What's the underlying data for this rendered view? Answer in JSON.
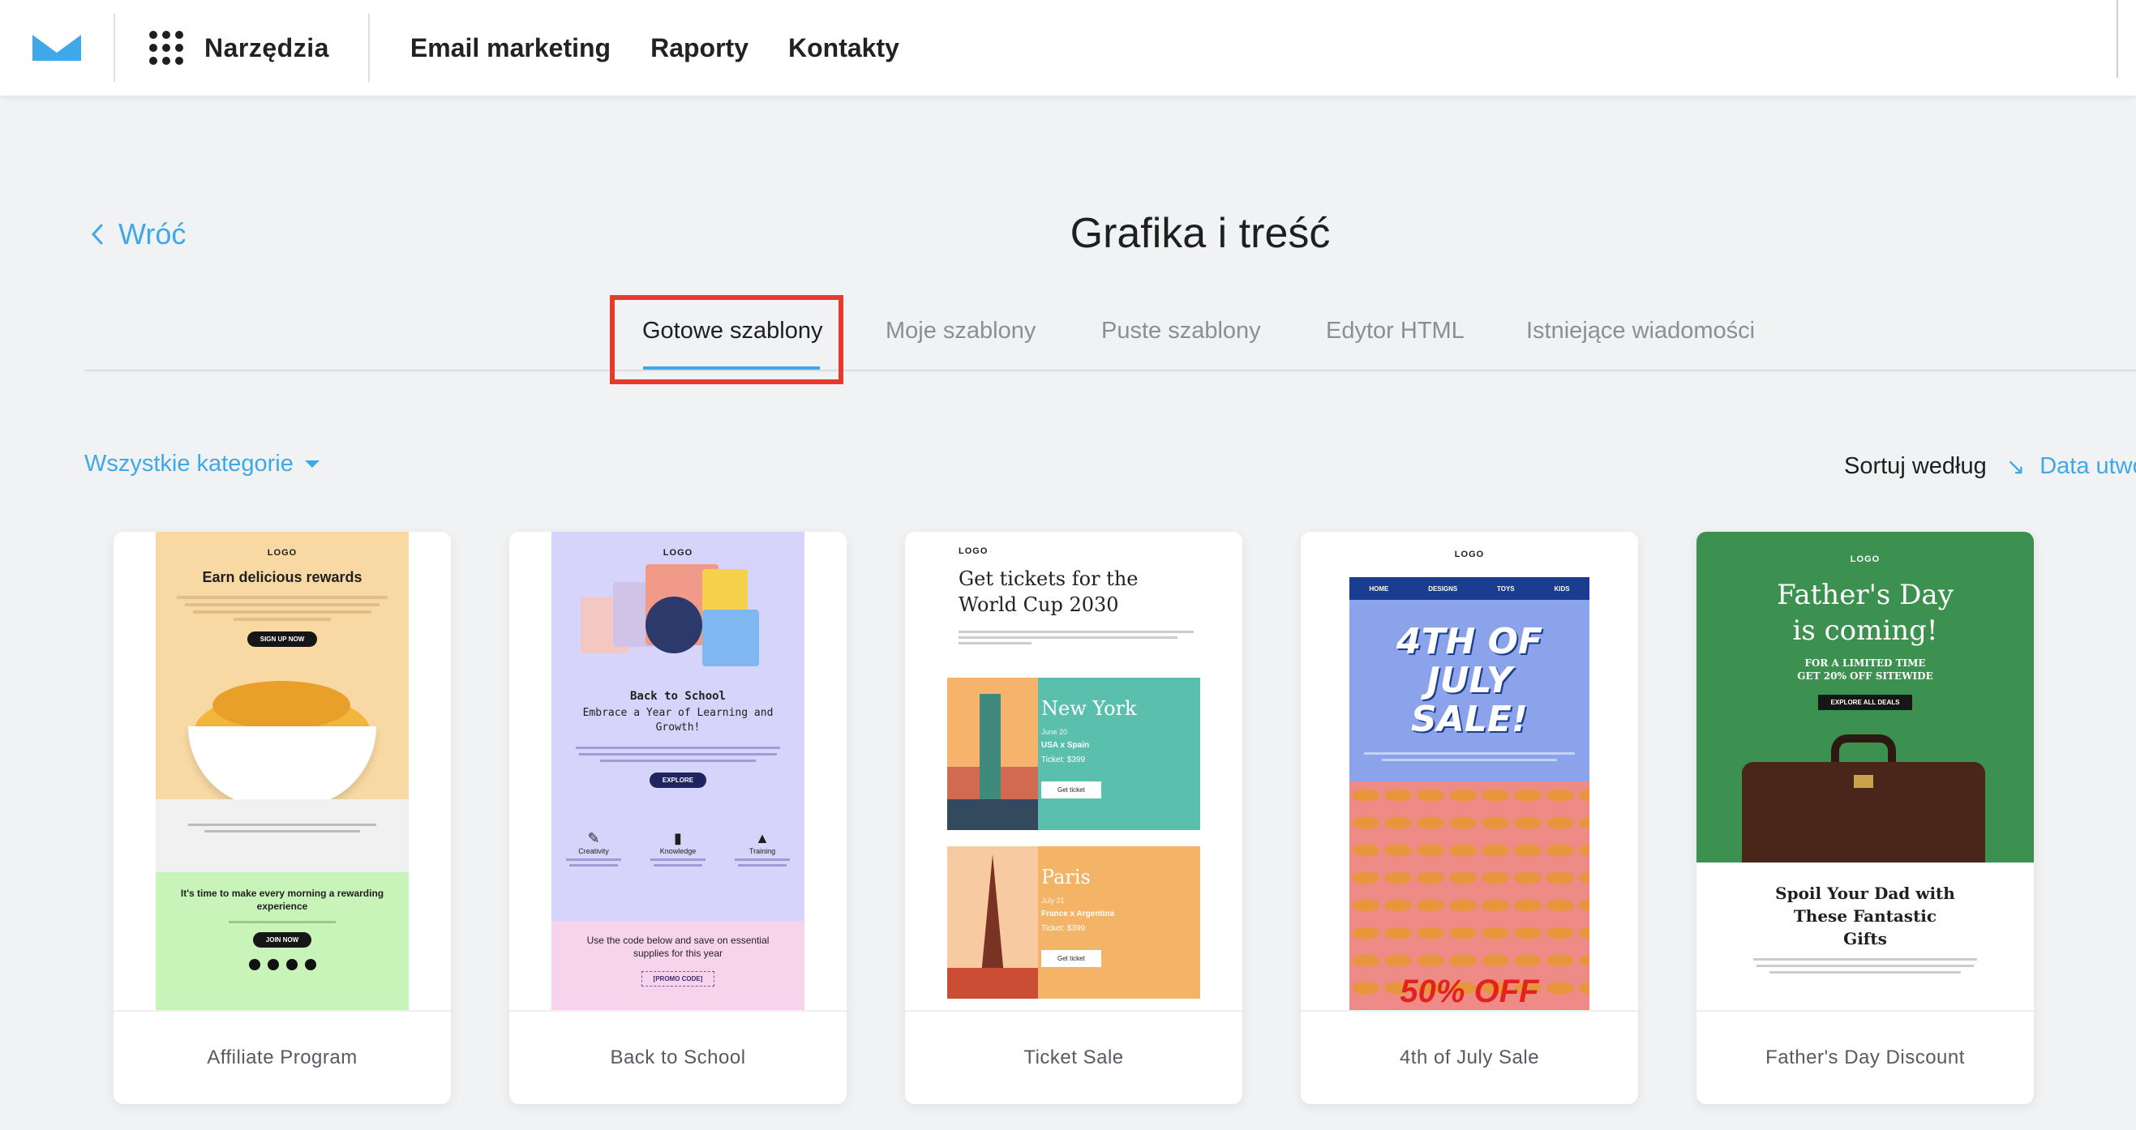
{
  "topbar": {
    "logo_icon": "envelope-logo-icon",
    "tools_icon": "grid-dots-icon",
    "tools_label": "Narzędzia",
    "nav": [
      "Email marketing",
      "Raporty",
      "Kontakty"
    ]
  },
  "back_label": "Wróć",
  "page_title": "Grafika i treść",
  "tabs": [
    {
      "label": "Gotowe szablony",
      "active": true
    },
    {
      "label": "Moje szablony",
      "active": false
    },
    {
      "label": "Puste szablony",
      "active": false
    },
    {
      "label": "Edytor HTML",
      "active": false
    },
    {
      "label": "Istniejące wiadomości",
      "active": false
    }
  ],
  "filter": {
    "category_label": "Wszystkie kategorie"
  },
  "sort": {
    "label": "Sortuj według",
    "value": "Data utwo"
  },
  "colors": {
    "accent": "#3fa8e8",
    "highlight": "#e43b2c",
    "background": "#f1f2f4"
  },
  "templates": [
    {
      "name": "Affiliate Program",
      "preview": {
        "logo": "LOGO",
        "headline": "Earn delicious rewards",
        "button1": "SIGN UP NOW",
        "section_title": "It's time to make every morning a rewarding experience",
        "button2": "JOIN NOW"
      }
    },
    {
      "name": "Back to School",
      "preview": {
        "logo": "LOGO",
        "title": "Back to School",
        "subtitle": "Embrace a Year of Learning and Growth!",
        "button": "EXPLORE",
        "features": [
          "Creativity",
          "Knowledge",
          "Training"
        ],
        "promo_text": "Use the code below and save on essential supplies for this year",
        "promo_code": "[PROMO CODE]"
      }
    },
    {
      "name": "Ticket Sale",
      "preview": {
        "logo": "LOGO",
        "headline": "Get tickets for the World Cup 2030",
        "events": [
          {
            "city": "New York",
            "date": "June 20",
            "match": "USA x Spain",
            "price": "Ticket: $399",
            "button": "Get ticket"
          },
          {
            "city": "Paris",
            "date": "July 21",
            "match": "France x Argentina",
            "price": "Ticket: $399",
            "button": "Get ticket"
          }
        ]
      }
    },
    {
      "name": "4th of July Sale",
      "preview": {
        "logo": "LOGO",
        "menu": [
          "HOME",
          "DESIGNS",
          "TOYS",
          "KIDS"
        ],
        "headline": "4TH OF JULY SALE!",
        "offer": "50% OFF"
      }
    },
    {
      "name": "Father's Day Discount",
      "preview": {
        "logo": "LOGO",
        "headline": "Father's Day is coming!",
        "subline": "FOR A LIMITED TIME GET 20% OFF SITEWIDE",
        "button": "EXPLORE ALL DEALS",
        "section_title": "Spoil Your Dad with These Fantastic Gifts"
      }
    }
  ]
}
